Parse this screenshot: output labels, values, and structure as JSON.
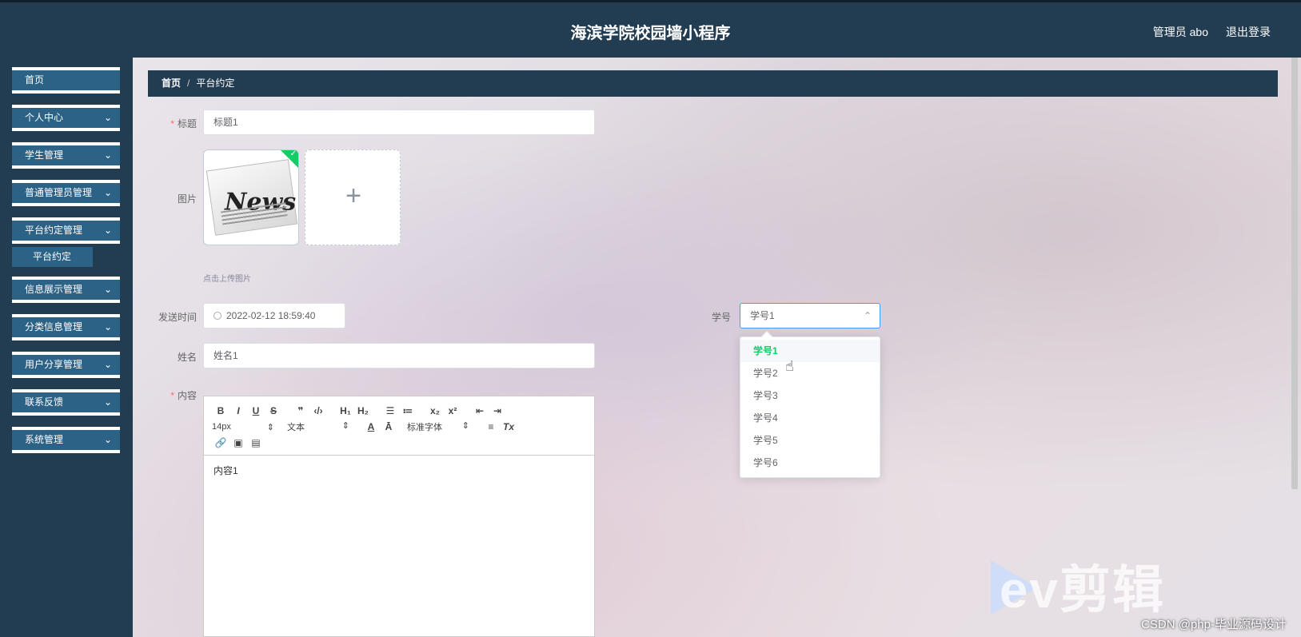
{
  "header": {
    "title": "海滨学院校园墙小程序",
    "user": "管理员 abo",
    "logout": "退出登录"
  },
  "sidebar": {
    "items": [
      {
        "label": "首页",
        "chevron": false
      },
      {
        "label": "个人中心",
        "chevron": true
      },
      {
        "label": "学生管理",
        "chevron": true
      },
      {
        "label": "普通管理员管理",
        "chevron": true
      },
      {
        "label": "平台约定管理",
        "chevron": true
      },
      {
        "label": "信息展示管理",
        "chevron": true
      },
      {
        "label": "分类信息管理",
        "chevron": true
      },
      {
        "label": "用户分享管理",
        "chevron": true
      },
      {
        "label": "联系反馈",
        "chevron": true
      },
      {
        "label": "系统管理",
        "chevron": true
      }
    ],
    "submenu": {
      "label": "平台约定"
    }
  },
  "breadcrumb": {
    "home": "首页",
    "separator": "/",
    "current": "平台约定"
  },
  "form": {
    "title": {
      "label": "标题",
      "value": "标题1"
    },
    "image": {
      "label": "图片",
      "thumb_text": "News",
      "hint": "点击上传图片"
    },
    "send_time": {
      "label": "发送时间",
      "value": "2022-02-12 18:59:40"
    },
    "student_no": {
      "label": "学号",
      "value": "学号1",
      "options": [
        "学号1",
        "学号2",
        "学号3",
        "学号4",
        "学号5",
        "学号6"
      ]
    },
    "name": {
      "label": "姓名",
      "value": "姓名1"
    },
    "content": {
      "label": "内容",
      "toolbar": {
        "font_size": "14px",
        "text_style": "文本",
        "font_family": "标准字体"
      },
      "body": "内容1"
    }
  },
  "watermark": {
    "logo": "ev剪辑",
    "credit": "CSDN @php-毕业源码设计"
  },
  "colors": {
    "header_bg": "#223d52",
    "menu_bg": "#2d6287",
    "accent": "#13ce66",
    "required": "#f56c6c"
  }
}
